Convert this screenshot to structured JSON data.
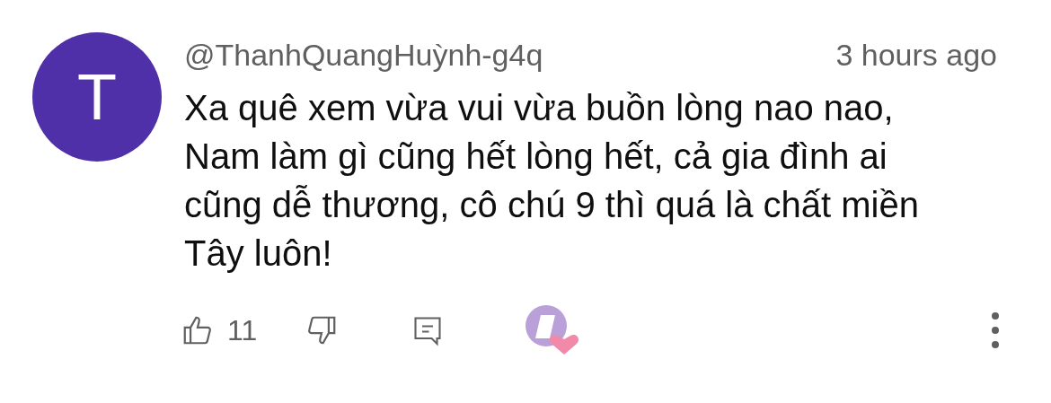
{
  "comment": {
    "avatar_letter": "T",
    "author": "@ThanhQuangHuỳnh-g4q",
    "time": "3 hours ago",
    "text": "Xa quê xem vừa vui vừa buồn lòng nao nao, Nam làm gì cũng hết lòng hết, cả gia đình ai cũng dễ thương, cô chú 9 thì quá là chất miền Tây luôn!",
    "like_count": "11",
    "creator_hearted": true
  }
}
